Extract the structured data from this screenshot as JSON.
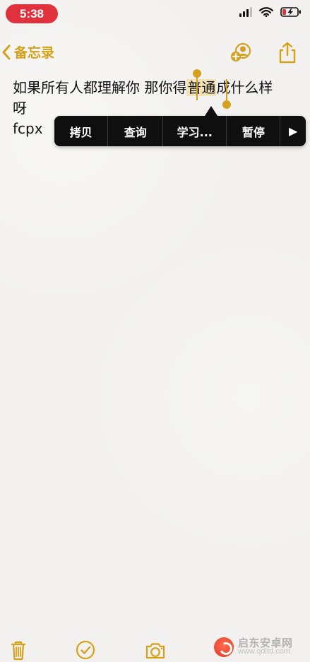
{
  "status_bar": {
    "time": "5:38",
    "icons": {
      "signal": "cellular-signal-icon",
      "wifi": "wifi-icon",
      "battery": "battery-low-charging-icon"
    }
  },
  "nav": {
    "back_label": "备忘录",
    "icons": {
      "back": "chevron-left-icon",
      "add_person": "add-person-icon",
      "share": "share-icon"
    }
  },
  "note": {
    "lines": [
      {
        "before": "如果所有人都理解你 那你得",
        "selected": "普通",
        "after": "成什么样"
      },
      {
        "text": "呀"
      },
      {
        "text": "fcpx"
      }
    ]
  },
  "context_menu": {
    "items": [
      "拷贝",
      "查询",
      "学习...",
      "暂停"
    ],
    "more": "▶"
  },
  "toolbar": {
    "icons": {
      "trash": "trash-icon",
      "checklist": "checklist-icon",
      "camera": "camera-icon"
    }
  },
  "watermark": {
    "title": "启东安卓网",
    "url": "www.qdltd.com"
  },
  "colors": {
    "accent": "#d3a11c",
    "status_pill": "#e0313d",
    "menu_bg": "#0f0f10",
    "selection_bg": "#f3e2b8"
  }
}
